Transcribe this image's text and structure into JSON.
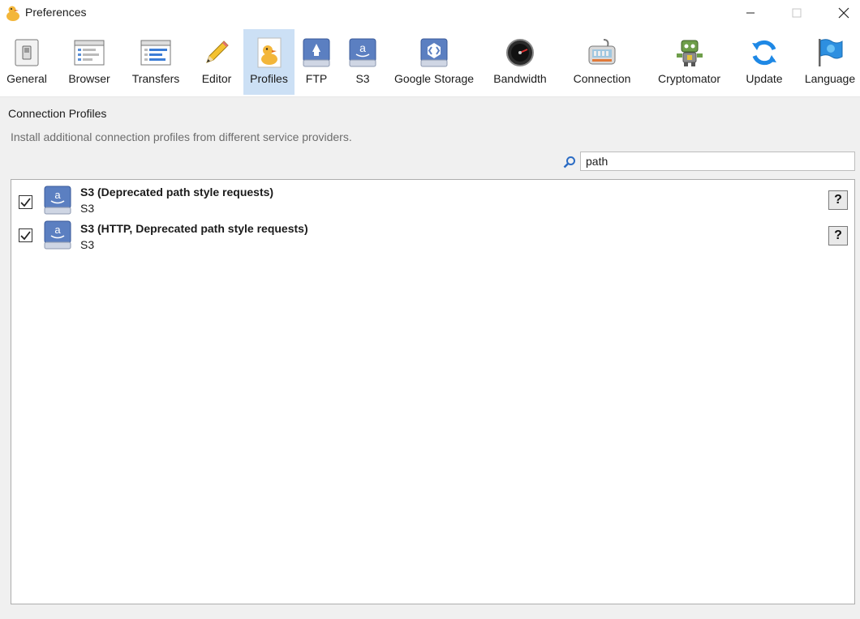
{
  "window": {
    "title": "Preferences"
  },
  "toolbar": {
    "items": [
      {
        "label": "General",
        "icon": "general-icon"
      },
      {
        "label": "Browser",
        "icon": "browser-icon"
      },
      {
        "label": "Transfers",
        "icon": "transfers-icon"
      },
      {
        "label": "Editor",
        "icon": "pencil-icon"
      },
      {
        "label": "Profiles",
        "icon": "duck-icon",
        "selected": true
      },
      {
        "label": "FTP",
        "icon": "ftp-drive-icon"
      },
      {
        "label": "S3",
        "icon": "s3-drive-icon"
      },
      {
        "label": "Google Storage",
        "icon": "google-storage-icon"
      },
      {
        "label": "Bandwidth",
        "icon": "bandwidth-gauge-icon"
      },
      {
        "label": "Connection",
        "icon": "connection-icon"
      },
      {
        "label": "Cryptomator",
        "icon": "cryptomator-robot-icon"
      },
      {
        "label": "Update",
        "icon": "update-arrows-icon"
      },
      {
        "label": "Language",
        "icon": "language-flag-icon"
      }
    ]
  },
  "content": {
    "section_title": "Connection Profiles",
    "section_description": "Install additional connection profiles from different service providers.",
    "search": {
      "value": "path"
    },
    "profiles": [
      {
        "title": "S3 (Deprecated path style requests)",
        "subtitle": "S3",
        "checked": true,
        "help_label": "?"
      },
      {
        "title": "S3 (HTTP, Deprecated path style requests)",
        "subtitle": "S3",
        "checked": true,
        "help_label": "?"
      }
    ]
  },
  "colors": {
    "selected_tab": "#cce0f5",
    "accent_blue": "#2b6cc4",
    "amazon_drive": "#5b7fc1"
  }
}
